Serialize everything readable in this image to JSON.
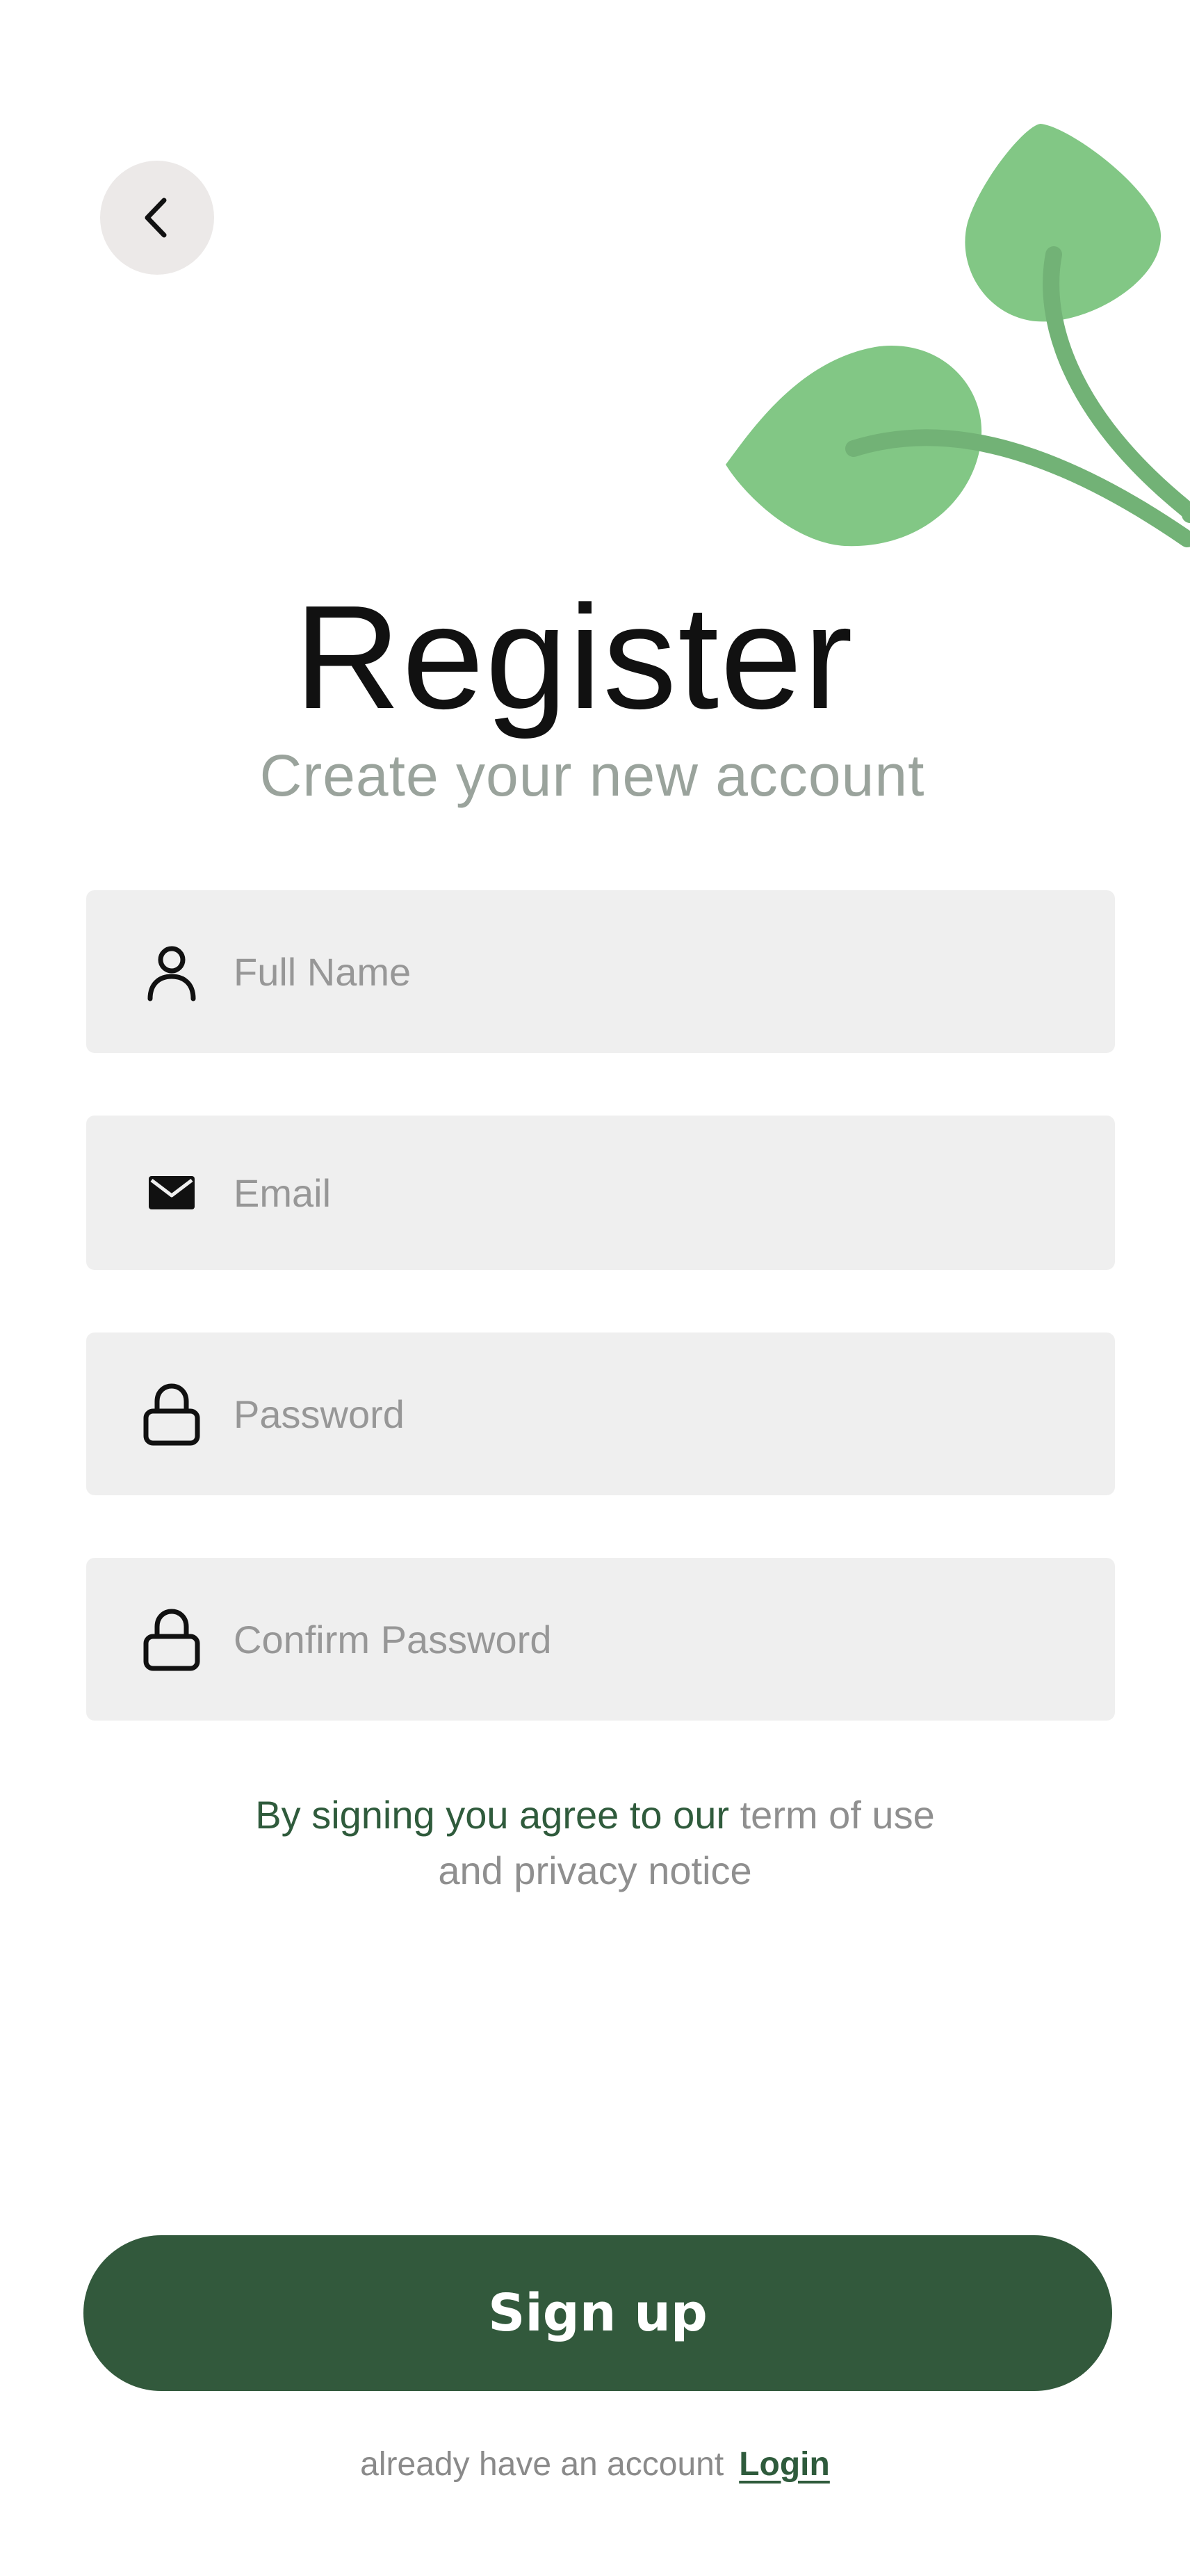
{
  "header": {
    "back_icon": "chevron-left-icon",
    "decoration": "leaves-illustration",
    "title": "Register",
    "subtitle": "Create your new account"
  },
  "form": {
    "full_name": {
      "placeholder": "Full Name",
      "value": "",
      "icon": "user-icon"
    },
    "email": {
      "placeholder": "Email",
      "value": "",
      "icon": "mail-icon"
    },
    "password": {
      "placeholder": "Password",
      "value": "",
      "icon": "lock-icon"
    },
    "confirm_password": {
      "placeholder": "Confirm Password",
      "value": "",
      "icon": "lock-icon"
    }
  },
  "terms": {
    "lead": "By signing you agree to our",
    "link_terms": "term of use",
    "link_privacy": "and privacy notice"
  },
  "actions": {
    "signup_label": "Sign up",
    "footer_prompt": "already have an account",
    "login_label": "Login"
  },
  "colors": {
    "primary": "#32593c",
    "leaf": "#82c785",
    "leaf_vein": "#6daf71",
    "field_bg": "#efefef",
    "subtitle": "#9aa39c",
    "back_button_bg": "#ece9e8"
  }
}
